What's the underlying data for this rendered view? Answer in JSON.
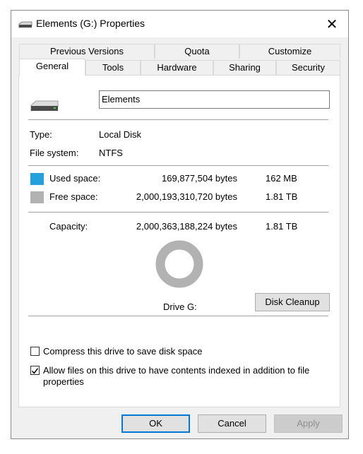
{
  "window": {
    "title": "Elements (G:) Properties",
    "close_symbol": "✕"
  },
  "tabs_back": [
    "Previous Versions",
    "Quota",
    "Customize"
  ],
  "tabs_front": [
    "General",
    "Tools",
    "Hardware",
    "Sharing",
    "Security"
  ],
  "active_tab": "General",
  "drive": {
    "name": "Elements",
    "icon": "drive-icon"
  },
  "info": {
    "type_label": "Type:",
    "type_value": "Local Disk",
    "fs_label": "File system:",
    "fs_value": "NTFS"
  },
  "space": {
    "used_label": "Used space:",
    "used_bytes": "169,877,504 bytes",
    "used_size": "162 MB",
    "used_color": "#26a0da",
    "free_label": "Free space:",
    "free_bytes": "2,000,193,310,720 bytes",
    "free_size": "1.81 TB",
    "free_color": "#b2b2b2",
    "capacity_label": "Capacity:",
    "capacity_bytes": "2,000,363,188,224 bytes",
    "capacity_size": "1.81 TB",
    "used_fraction": 8.49e-05
  },
  "drive_label": "Drive G:",
  "disk_cleanup": "Disk Cleanup",
  "options": {
    "compress_label": "Compress this drive to save disk space",
    "compress_checked": false,
    "index_label_line1": "Allow files on this drive to have contents indexed in addition to file",
    "index_label_line2": "properties",
    "index_checked": true
  },
  "buttons": {
    "ok": "OK",
    "cancel": "Cancel",
    "apply": "Apply"
  }
}
